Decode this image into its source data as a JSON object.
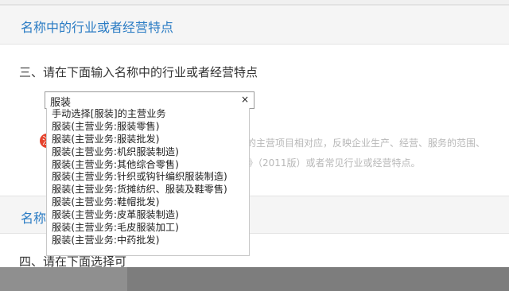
{
  "section1": {
    "title": "名称中的行业或者经营特点"
  },
  "question3": {
    "text": "三、请在下面输入名称中的行业或者经营特点"
  },
  "search": {
    "value": "服装",
    "clear_label": "×"
  },
  "dropdown": {
    "items": [
      "手动选择[服装]的主营业务",
      "服装(主营业务:服装零售)",
      "服装(主营业务:服装批发)",
      "服装(主营业务:机织服装制造)",
      "服装(主营业务:其他综合零售)",
      "服装(主营业务:针织或钩针编织服装制造)",
      "服装(主营业务:货摊纺织、服装及鞋零售)",
      "服装(主营业务:鞋帽批发)",
      "服装(主营业务:皮革服装制造)",
      "服装(主营业务:毛皮服装加工)",
      "服装(主营业务:中药批发)"
    ]
  },
  "hint": {
    "badge": "注",
    "line1": "的主营项目相对应，反映企业生产、经营、服务的范围、",
    "line2": "》（2011版）或者常见行业或经营特点。"
  },
  "section2": {
    "title": "名称中"
  },
  "question4": {
    "text": "四、请在下面选择可"
  }
}
